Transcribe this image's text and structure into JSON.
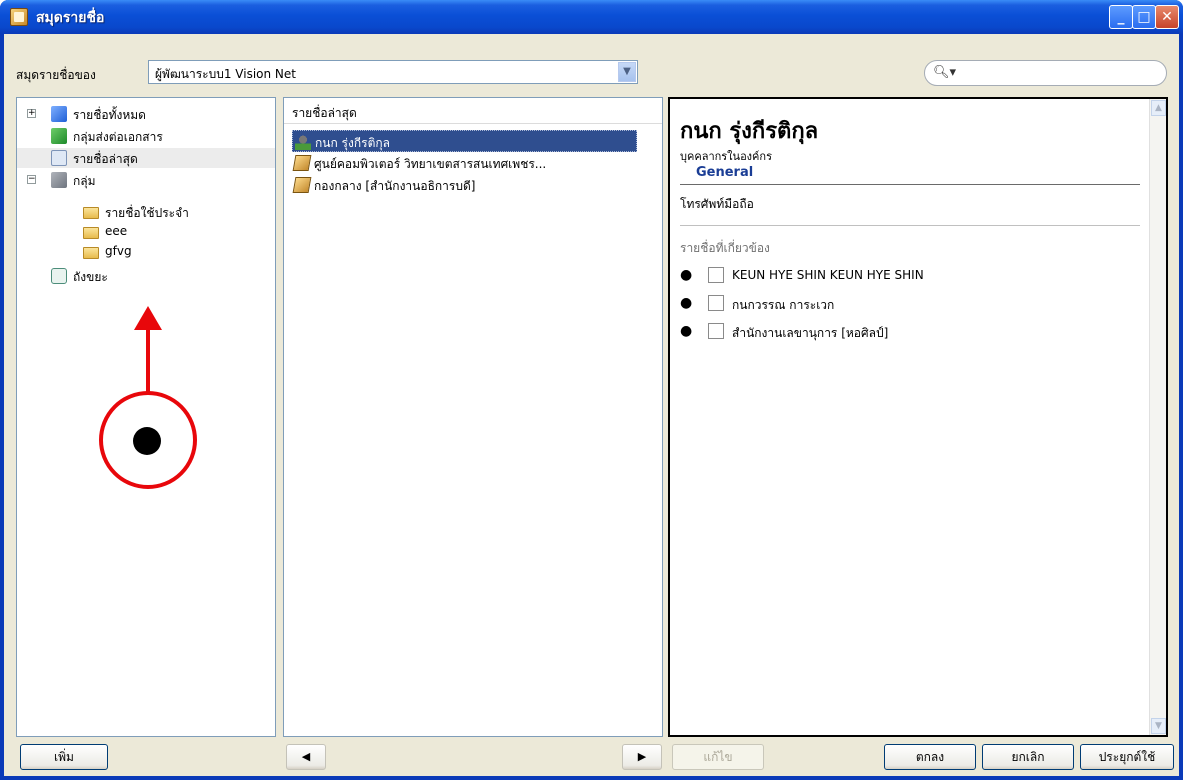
{
  "window": {
    "title": "สมุดรายชื่อ"
  },
  "toolbar": {
    "address_book_label": "สมุดรายชื่อของ",
    "address_book_value": "ผู้พัฒนาระบบ1 Vision Net",
    "search_placeholder": ""
  },
  "tree": {
    "items": [
      {
        "label": "รายชื่อทั้งหมด",
        "icon": "all-contacts-icon",
        "expander": "+"
      },
      {
        "label": "กลุ่มส่งต่อเอกสาร",
        "icon": "forward-group-icon"
      },
      {
        "label": "รายชื่อล่าสุด",
        "icon": "recent-contacts-icon",
        "selected": true
      },
      {
        "label": "กลุ่ม",
        "icon": "groups-icon",
        "expander": "−"
      },
      {
        "label": "รายชื่อใช้ประจำ",
        "icon": "favorites-folder-icon"
      },
      {
        "label": "eee",
        "icon": "folder-icon"
      },
      {
        "label": "gfvg",
        "icon": "folder-icon"
      },
      {
        "label": "ถังขยะ",
        "icon": "trash-icon"
      }
    ]
  },
  "list": {
    "header": "รายชื่อล่าสุด",
    "items": [
      {
        "label": "กนก รุ่งกีรติกุล",
        "icon": "person-icon",
        "selected": true
      },
      {
        "label": "ศูนย์คอมพิวเตอร์ วิทยาเขตสารสนเทศเพชร...",
        "icon": "organization-icon"
      },
      {
        "label": "กองกลาง [สำนักงานอธิการบดี]",
        "icon": "organization-icon"
      }
    ]
  },
  "detail": {
    "name": "กนก รุ่งกีรติกุล",
    "subtitle": "บุคคลากรในองค์กร",
    "section": "General",
    "phone_label": "โทรศัพท์มือถือ",
    "related_label": "รายชื่อที่เกี่ยวข้อง",
    "related": [
      "KEUN HYE SHIN KEUN HYE SHIN",
      "กนกวรรณ การะเวก",
      "สำนักงานเลขานุการ [หอศิลป์]"
    ]
  },
  "buttons": {
    "add": "เพิ่ม",
    "edit": "แก้ไข",
    "ok": "ตกลง",
    "cancel": "ยกเลิก",
    "apply": "ประยุกต์ใช้"
  },
  "colors": {
    "titlebar": "#0a4fd6",
    "selection": "#2f4e8f",
    "annotation": "#e8070b"
  }
}
